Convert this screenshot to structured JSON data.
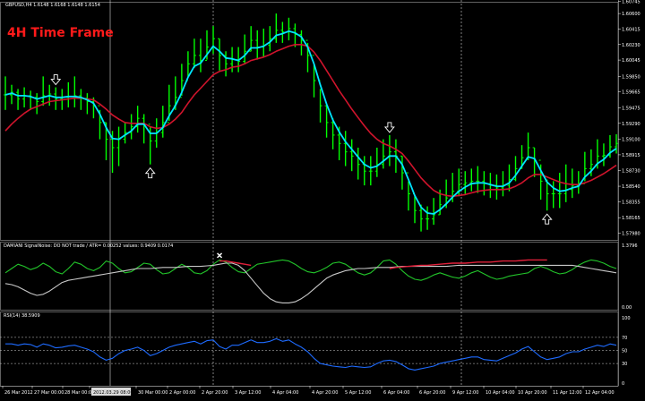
{
  "header": {
    "main_title": "GBPUSD,H4  1.6148  1.6168  1.6148  1.6154",
    "timeframe_label": "4H Time Frame",
    "indicator1_title": "DAMIANI SignalNoise: DO NOT trade  / ATR= 0.00252     values: 0.9409  0.0174",
    "indicator2_title": "RSI(14) 38.5909"
  },
  "colors": {
    "background": "#000000",
    "candle": "#00ff00",
    "fast_ma": "#00e5ff",
    "slow_ma": "#d0142c",
    "damiani_signal": "#22c42a",
    "damiani_noise": "#c8c8c8",
    "damiani_threshold": "#e0203a",
    "rsi_line": "#1e6bff",
    "grid": "#ffffff",
    "axis_text": "#ffffff"
  },
  "chart_data": [
    {
      "type": "line",
      "name": "price",
      "ylim": [
        1.579,
        1.6074
      ],
      "price_tick_labels": [
        "1.60745",
        "1.60600",
        "1.60415",
        "1.60230",
        "1.60045",
        "1.59850",
        "1.59665",
        "1.59475",
        "1.59290",
        "1.59100",
        "1.58915",
        "1.58730",
        "1.58540",
        "1.58355",
        "1.58165",
        "1.57980"
      ],
      "price_tick_values": [
        1.60745,
        1.606,
        1.60415,
        1.6023,
        1.60045,
        1.5985,
        1.59665,
        1.59475,
        1.5929,
        1.591,
        1.58915,
        1.5873,
        1.5854,
        1.58355,
        1.58165,
        1.5798
      ],
      "series": [
        {
          "key": "close",
          "values": [
            1.5963,
            1.5966,
            1.5958,
            1.5962,
            1.596,
            1.5955,
            1.5962,
            1.5964,
            1.5958,
            1.596,
            1.5961,
            1.5962,
            1.5959,
            1.5955,
            1.595,
            1.593,
            1.591,
            1.59,
            1.591,
            1.5918,
            1.5925,
            1.5935,
            1.5928,
            1.5908,
            1.5918,
            1.593,
            1.595,
            1.596,
            1.598,
            1.6,
            1.601,
            1.6004,
            1.602,
            1.603,
            1.601,
            1.6,
            1.6005,
            1.6003,
            1.6015,
            1.6028,
            1.602,
            1.6022,
            1.603,
            1.604,
            1.6038,
            1.6042,
            1.6035,
            1.6028,
            1.601,
            1.598,
            1.595,
            1.593,
            1.5915,
            1.5905,
            1.5895,
            1.589,
            1.588,
            1.5872,
            1.5872,
            1.588,
            1.589,
            1.5895,
            1.589,
            1.587,
            1.5845,
            1.5825,
            1.5815,
            1.5815,
            1.582,
            1.5832,
            1.584,
            1.5848,
            1.5856,
            1.5858,
            1.586,
            1.586,
            1.5857,
            1.5855,
            1.5852,
            1.5855,
            1.5862,
            1.5875,
            1.5888,
            1.59,
            1.5885,
            1.586,
            1.5845,
            1.5845,
            1.5845,
            1.585,
            1.5855,
            1.5857,
            1.5875,
            1.588,
            1.589,
            1.5891,
            1.5901,
            1.5905
          ]
        },
        {
          "key": "high",
          "values": [
            1.5985,
            1.5975,
            1.597,
            1.5972,
            1.5968,
            1.5965,
            1.5985,
            1.5975,
            1.5972,
            1.597,
            1.5978,
            1.5985,
            1.597,
            1.5965,
            1.596,
            1.5945,
            1.593,
            1.592,
            1.5925,
            1.593,
            1.594,
            1.595,
            1.594,
            1.5925,
            1.5935,
            1.595,
            1.5975,
            1.5985,
            1.6,
            1.6015,
            1.603,
            1.603,
            1.604,
            1.6045,
            1.603,
            1.6015,
            1.602,
            1.602,
            1.6035,
            1.6045,
            1.604,
            1.6042,
            1.6045,
            1.606,
            1.605,
            1.6055,
            1.6048,
            1.604,
            1.6025,
            1.6,
            1.597,
            1.595,
            1.5935,
            1.5925,
            1.592,
            1.591,
            1.59,
            1.589,
            1.589,
            1.59,
            1.591,
            1.5915,
            1.591,
            1.589,
            1.586,
            1.5842,
            1.5832,
            1.583,
            1.584,
            1.585,
            1.5862,
            1.587,
            1.5875,
            1.5872,
            1.5875,
            1.5878,
            1.5872,
            1.587,
            1.5868,
            1.5872,
            1.588,
            1.589,
            1.5903,
            1.5918,
            1.59,
            1.588,
            1.5862,
            1.586,
            1.587,
            1.588,
            1.5875,
            1.5872,
            1.5895,
            1.5898,
            1.591,
            1.5905,
            1.5915,
            1.5916
          ]
        },
        {
          "key": "low",
          "values": [
            1.5945,
            1.5952,
            1.5945,
            1.5948,
            1.5945,
            1.594,
            1.595,
            1.595,
            1.5945,
            1.5945,
            1.5948,
            1.5948,
            1.5945,
            1.594,
            1.5935,
            1.591,
            1.5885,
            1.587,
            1.5878,
            1.5905,
            1.591,
            1.5918,
            1.5905,
            1.588,
            1.59,
            1.5912,
            1.5932,
            1.5945,
            1.5962,
            1.5985,
            1.5995,
            1.599,
            1.6005,
            1.6012,
            1.5992,
            1.5985,
            1.599,
            1.599,
            1.6,
            1.6015,
            1.6005,
            1.6008,
            1.6015,
            1.6025,
            1.6025,
            1.6028,
            1.602,
            1.601,
            1.599,
            1.596,
            1.593,
            1.5912,
            1.5898,
            1.5885,
            1.5878,
            1.5872,
            1.5862,
            1.5855,
            1.5855,
            1.5865,
            1.5875,
            1.5878,
            1.587,
            1.585,
            1.5825,
            1.581,
            1.58,
            1.5802,
            1.5808,
            1.582,
            1.5828,
            1.5835,
            1.5842,
            1.5845,
            1.5848,
            1.5846,
            1.5843,
            1.584,
            1.5838,
            1.5842,
            1.5848,
            1.586,
            1.5875,
            1.5885,
            1.5865,
            1.5838,
            1.5825,
            1.5828,
            1.5828,
            1.5835,
            1.584,
            1.5845,
            1.586,
            1.5866,
            1.5875,
            1.5878,
            1.5888,
            1.5893
          ]
        },
        {
          "key": "fast_ma",
          "values": [
            1.5963,
            1.5965,
            1.5962,
            1.5962,
            1.5961,
            1.5958,
            1.596,
            1.5962,
            1.596,
            1.596,
            1.5961,
            1.5961,
            1.596,
            1.5957,
            1.5953,
            1.594,
            1.5924,
            1.5911,
            1.591,
            1.5915,
            1.592,
            1.5928,
            1.5928,
            1.5917,
            1.5917,
            1.5924,
            1.5938,
            1.595,
            1.5966,
            1.5984,
            1.5997,
            1.6001,
            1.6011,
            1.6021,
            1.6015,
            1.6007,
            1.6006,
            1.6004,
            1.601,
            1.6019,
            1.6019,
            1.6021,
            1.6026,
            1.6034,
            1.6036,
            1.6039,
            1.6037,
            1.6032,
            1.602,
            1.6,
            1.5975,
            1.5952,
            1.5933,
            1.5919,
            1.5907,
            1.5898,
            1.5889,
            1.588,
            1.5876,
            1.5878,
            1.5884,
            1.589,
            1.589,
            1.588,
            1.5862,
            1.5843,
            1.5829,
            1.5822,
            1.5821,
            1.5826,
            1.5833,
            1.5841,
            1.5848,
            1.5853,
            1.5857,
            1.5858,
            1.5858,
            1.5856,
            1.5854,
            1.5854,
            1.5858,
            1.5867,
            1.5878,
            1.5889,
            1.5887,
            1.5873,
            1.5859,
            1.5852,
            1.5848,
            1.5849,
            1.5852,
            1.5854,
            1.5865,
            1.5872,
            1.5881,
            1.5886,
            1.5894,
            1.5899
          ]
        },
        {
          "key": "slow_ma",
          "values": [
            1.592,
            1.5928,
            1.5935,
            1.5941,
            1.5946,
            1.5949,
            1.5952,
            1.5955,
            1.5956,
            1.5957,
            1.5958,
            1.5959,
            1.5959,
            1.5958,
            1.5957,
            1.5952,
            1.5946,
            1.5939,
            1.5934,
            1.593,
            1.5929,
            1.5929,
            1.5929,
            1.5925,
            1.5923,
            1.5924,
            1.5928,
            1.5934,
            1.5942,
            1.5953,
            1.5963,
            1.5971,
            1.5979,
            1.5987,
            1.5991,
            1.5993,
            1.5996,
            1.5997,
            1.6,
            1.6004,
            1.6006,
            1.6008,
            1.6011,
            1.6015,
            1.6018,
            1.6021,
            1.6023,
            1.6023,
            1.6021,
            1.6014,
            1.6004,
            1.5992,
            1.598,
            1.5968,
            1.5957,
            1.5946,
            1.5936,
            1.5926,
            1.5917,
            1.591,
            1.5905,
            1.5902,
            1.5898,
            1.5893,
            1.5884,
            1.5874,
            1.5864,
            1.5856,
            1.5849,
            1.5845,
            1.5843,
            1.5842,
            1.5843,
            1.5844,
            1.5846,
            1.5848,
            1.5849,
            1.585,
            1.585,
            1.585,
            1.5851,
            1.5854,
            1.5858,
            1.5864,
            1.5868,
            1.5868,
            1.5865,
            1.5862,
            1.5859,
            1.5857,
            1.5856,
            1.5856,
            1.5858,
            1.5861,
            1.5865,
            1.5869,
            1.5874,
            1.5879
          ]
        }
      ],
      "signals": [
        {
          "type": "down",
          "index": 8
        },
        {
          "type": "up",
          "index": 23
        },
        {
          "type": "down",
          "index": 61
        },
        {
          "type": "up",
          "index": 86
        }
      ],
      "x_tick_labels": [
        "26 Mar 2012",
        "27 Mar 00:00",
        "28 Mar 00:00",
        "29 Mar 00:00",
        "30 Mar 00:00",
        "2 Apr 00:00",
        "2 Apr 20:00",
        "3 Apr 12:00",
        "4 Apr 04:00",
        "4 Apr 20:00",
        "5 Apr 12:00",
        "6 Apr 04:00",
        "6 Apr 20:00",
        "9 Apr 12:00",
        "10 Apr 04:00",
        "10 Apr 20:00",
        "11 Apr 12:00",
        "12 Apr 04:00"
      ],
      "x_cursor_label": "2012.03.29 08:00"
    },
    {
      "type": "line",
      "name": "damiani",
      "y_tick_labels": [
        "1.3796",
        "0.00"
      ],
      "series": [
        {
          "key": "signal",
          "values": [
            0.62,
            0.7,
            0.78,
            0.74,
            0.68,
            0.72,
            0.8,
            0.74,
            0.64,
            0.6,
            0.7,
            0.82,
            0.78,
            0.7,
            0.66,
            0.72,
            0.84,
            0.8,
            0.7,
            0.62,
            0.64,
            0.72,
            0.8,
            0.78,
            0.68,
            0.6,
            0.62,
            0.7,
            0.78,
            0.72,
            0.62,
            0.6,
            0.66,
            0.78,
            0.86,
            0.82,
            0.72,
            0.64,
            0.62,
            0.7,
            0.78,
            0.8,
            0.82,
            0.84,
            0.86,
            0.84,
            0.78,
            0.7,
            0.64,
            0.62,
            0.66,
            0.72,
            0.8,
            0.82,
            0.78,
            0.7,
            0.62,
            0.58,
            0.62,
            0.72,
            0.84,
            0.86,
            0.78,
            0.66,
            0.56,
            0.5,
            0.48,
            0.52,
            0.58,
            0.62,
            0.58,
            0.54,
            0.52,
            0.56,
            0.62,
            0.66,
            0.6,
            0.54,
            0.5,
            0.52,
            0.56,
            0.58,
            0.6,
            0.62,
            0.7,
            0.74,
            0.7,
            0.64,
            0.6,
            0.62,
            0.68,
            0.76,
            0.82,
            0.86,
            0.84,
            0.8,
            0.74,
            0.7
          ]
        },
        {
          "key": "noise",
          "values": [
            0.42,
            0.4,
            0.36,
            0.3,
            0.24,
            0.2,
            0.22,
            0.28,
            0.36,
            0.44,
            0.48,
            0.5,
            0.52,
            0.54,
            0.56,
            0.58,
            0.6,
            0.62,
            0.64,
            0.66,
            0.68,
            0.7,
            0.7,
            0.7,
            0.71,
            0.72,
            0.72,
            0.72,
            0.73,
            0.74,
            0.74,
            0.74,
            0.75,
            0.76,
            0.78,
            0.8,
            0.8,
            0.76,
            0.66,
            0.52,
            0.38,
            0.24,
            0.14,
            0.08,
            0.06,
            0.06,
            0.08,
            0.14,
            0.22,
            0.32,
            0.42,
            0.52,
            0.58,
            0.62,
            0.66,
            0.68,
            0.7,
            0.7,
            0.71,
            0.72,
            0.72,
            0.72,
            0.73,
            0.74,
            0.74,
            0.74,
            0.74,
            0.74,
            0.74,
            0.74,
            0.74,
            0.75,
            0.76,
            0.76,
            0.76,
            0.76,
            0.76,
            0.76,
            0.76,
            0.76,
            0.76,
            0.76,
            0.76,
            0.76,
            0.76,
            0.76,
            0.76,
            0.76,
            0.76,
            0.76,
            0.76,
            0.74,
            0.72,
            0.7,
            0.68,
            0.66,
            0.64,
            0.62
          ]
        },
        {
          "key": "threshold",
          "values": [
            null,
            null,
            null,
            null,
            null,
            null,
            null,
            null,
            null,
            null,
            null,
            null,
            null,
            null,
            null,
            null,
            null,
            null,
            null,
            null,
            null,
            null,
            null,
            null,
            null,
            null,
            null,
            null,
            null,
            null,
            null,
            null,
            null,
            null,
            0.84,
            0.84,
            0.82,
            0.8,
            0.78,
            0.76,
            null,
            null,
            null,
            null,
            null,
            null,
            null,
            null,
            null,
            null,
            null,
            null,
            null,
            null,
            null,
            null,
            null,
            null,
            null,
            null,
            null,
            0.7,
            0.72,
            0.73,
            0.74,
            0.75,
            0.76,
            0.76,
            0.77,
            0.78,
            0.79,
            0.8,
            0.8,
            0.8,
            0.81,
            0.82,
            0.82,
            0.82,
            0.83,
            0.84,
            0.84,
            0.84,
            0.85,
            0.86,
            0.86,
            0.86,
            0.86,
            null,
            null,
            null,
            null,
            null,
            null,
            null,
            null,
            null,
            null,
            null
          ]
        }
      ],
      "marker_index": 34
    },
    {
      "type": "line",
      "name": "rsi",
      "ylim": [
        0,
        100
      ],
      "y_tick_labels": [
        "100",
        "70",
        "50",
        "30",
        "0"
      ],
      "levels": [
        70,
        50,
        30
      ],
      "series": [
        {
          "key": "rsi",
          "values": [
            60,
            60,
            58,
            60,
            59,
            55,
            60,
            58,
            54,
            55,
            57,
            58,
            55,
            52,
            48,
            40,
            35,
            38,
            45,
            50,
            52,
            55,
            50,
            42,
            45,
            50,
            55,
            58,
            60,
            62,
            64,
            60,
            65,
            66,
            56,
            52,
            58,
            58,
            62,
            66,
            62,
            62,
            64,
            68,
            64,
            66,
            60,
            55,
            48,
            38,
            30,
            28,
            26,
            25,
            24,
            26,
            25,
            24,
            25,
            30,
            34,
            35,
            33,
            28,
            22,
            20,
            22,
            24,
            26,
            30,
            32,
            34,
            36,
            38,
            40,
            40,
            36,
            35,
            34,
            38,
            42,
            46,
            52,
            56,
            48,
            40,
            36,
            38,
            40,
            45,
            48,
            48,
            52,
            55,
            58,
            56,
            60,
            58
          ]
        }
      ]
    }
  ]
}
